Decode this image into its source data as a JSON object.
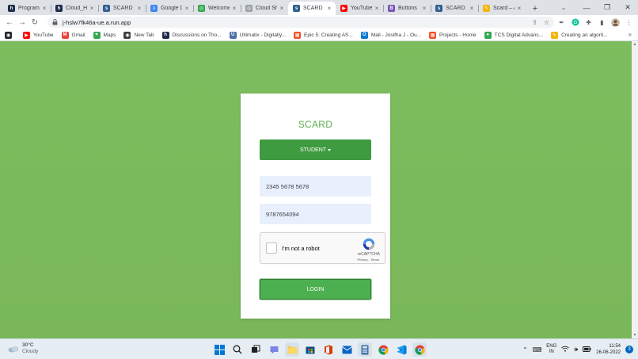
{
  "browser": {
    "tabs": [
      {
        "title": "Programs",
        "icon": "bolt-icon",
        "color": "#1f2b4a",
        "glyph": "h"
      },
      {
        "title": "Cloud_Ha",
        "icon": "bolt-icon",
        "color": "#1f2b4a",
        "glyph": "h"
      },
      {
        "title": "SCARD",
        "icon": "scard-icon",
        "color": "#2f5f8f",
        "glyph": "s"
      },
      {
        "title": "Google D",
        "icon": "docs-icon",
        "color": "#4285f4",
        "glyph": "≡"
      },
      {
        "title": "Welcome",
        "icon": "chrome-icon",
        "color": "#34a853",
        "glyph": "◎"
      },
      {
        "title": "Cloud Sh",
        "icon": "cloud-icon",
        "color": "#9aa0a6",
        "glyph": "◎"
      },
      {
        "title": "SCARD",
        "icon": "scard-icon",
        "color": "#2f5f8f",
        "glyph": "s",
        "active": true
      },
      {
        "title": "YouTube",
        "icon": "youtube-icon",
        "color": "#ff0000",
        "glyph": "▶"
      },
      {
        "title": "Buttons",
        "icon": "bootstrap-icon",
        "color": "#7952b3",
        "glyph": "B"
      },
      {
        "title": "SCARD",
        "icon": "scard-icon",
        "color": "#2f5f8f",
        "glyph": "s"
      },
      {
        "title": "Scard – A",
        "icon": "pencil-icon",
        "color": "#f4b400",
        "glyph": "✎"
      }
    ],
    "url": "j-hslw7fk46a-ue.a.run.app",
    "bookmarks": [
      {
        "title": "",
        "icon": "github-icon",
        "color": "#24292e",
        "glyph": "◉"
      },
      {
        "title": "YouTube",
        "icon": "youtube-icon",
        "color": "#ff0000",
        "glyph": "▶"
      },
      {
        "title": "Gmail",
        "icon": "gmail-icon",
        "color": "#ea4335",
        "glyph": "M"
      },
      {
        "title": "Maps",
        "icon": "maps-icon",
        "color": "#34a853",
        "glyph": "⌖"
      },
      {
        "title": "New Tab",
        "icon": "globe-icon",
        "color": "#3c4043",
        "glyph": "◉"
      },
      {
        "title": "Discussions on Tho...",
        "icon": "bolt-icon",
        "color": "#1f2b4a",
        "glyph": "h"
      },
      {
        "title": "Ultimatix - Digitally...",
        "icon": "ultimatix-icon",
        "color": "#4a6fa5",
        "glyph": "U"
      },
      {
        "title": "Epic 5: Creating AS...",
        "icon": "microsoft-icon",
        "color": "#f25022",
        "glyph": "▦"
      },
      {
        "title": "Mail - Josifha J - Ou...",
        "icon": "outlook-icon",
        "color": "#0078d4",
        "glyph": "O"
      },
      {
        "title": "Projects - Home",
        "icon": "microsoft-icon",
        "color": "#f25022",
        "glyph": "▦"
      },
      {
        "title": "TCS Digital Advanc...",
        "icon": "tcs-icon",
        "color": "#34a853",
        "glyph": "●"
      },
      {
        "title": "Creating an algorit...",
        "icon": "pencil-icon",
        "color": "#f4b400",
        "glyph": "✎"
      }
    ]
  },
  "login": {
    "title": "SCARD",
    "role_button": "STUDENT",
    "field_1": "2345 5678 5678",
    "field_2": "9787654094",
    "recaptcha_label": "I'm not a robot",
    "recaptcha_brand": "reCAPTCHA",
    "recaptcha_terms": "Privacy - Terms",
    "login_button": "LOGIN",
    "colors": {
      "title": "#5cae4a",
      "role": "#3f9b3f",
      "login": "#4caf50",
      "background": "#7cb85e"
    }
  },
  "taskbar": {
    "temperature": "30°C",
    "condition": "Cloudy",
    "language_line1": "ENG",
    "language_line2": "IN",
    "time": "11:54",
    "date": "26-06-2022",
    "notifications": "3"
  }
}
